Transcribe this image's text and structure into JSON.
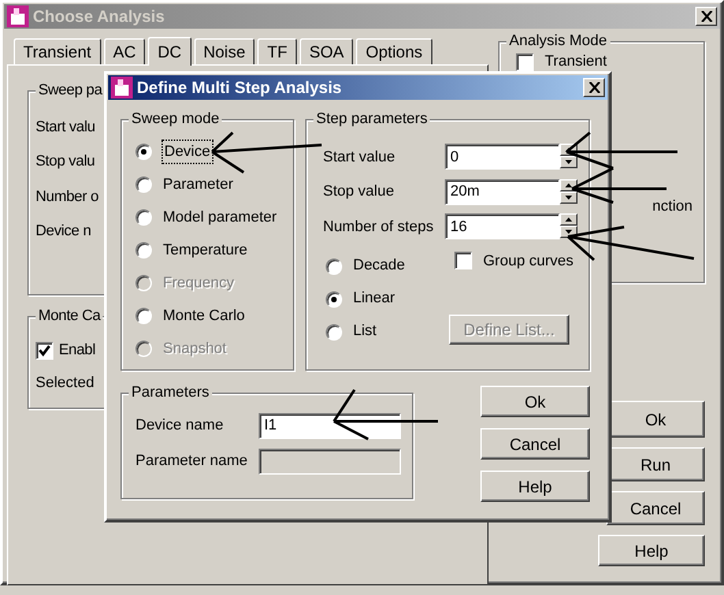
{
  "back_window": {
    "title": "Choose Analysis",
    "active": false,
    "tabs": [
      {
        "label": "Transient",
        "selected": false
      },
      {
        "label": "AC",
        "selected": false
      },
      {
        "label": "DC",
        "selected": true
      },
      {
        "label": "Noise",
        "selected": false
      },
      {
        "label": "TF",
        "selected": false
      },
      {
        "label": "SOA",
        "selected": false
      },
      {
        "label": "Options",
        "selected": false
      }
    ],
    "sweep_group": {
      "title": "Sweep pa",
      "labels": [
        "Start valu",
        "Stop valu",
        "Number o",
        "Device n"
      ]
    },
    "monte_carlo_group": {
      "title": "Monte Ca",
      "enable": {
        "label": "Enabl",
        "checked": true
      },
      "selected_label": "Selected"
    },
    "analysis_mode": {
      "title": "Analysis Mode",
      "transient": {
        "label": "Transient",
        "checked": false
      },
      "cut_label": "nction"
    },
    "buttons": [
      "Ok",
      "Run",
      "Cancel",
      "Help"
    ]
  },
  "dialog": {
    "title": "Define Multi Step Analysis",
    "active": true,
    "sweep_mode": {
      "title": "Sweep mode",
      "options": [
        {
          "label": "Device",
          "selected": true,
          "disabled": false
        },
        {
          "label": "Parameter",
          "selected": false,
          "disabled": false
        },
        {
          "label": "Model parameter",
          "selected": false,
          "disabled": false
        },
        {
          "label": "Temperature",
          "selected": false,
          "disabled": false
        },
        {
          "label": "Frequency",
          "selected": false,
          "disabled": true
        },
        {
          "label": "Monte Carlo",
          "selected": false,
          "disabled": false
        },
        {
          "label": "Snapshot",
          "selected": false,
          "disabled": true
        }
      ]
    },
    "step_parameters": {
      "title": "Step parameters",
      "fields": [
        {
          "label": "Start value",
          "value": "0"
        },
        {
          "label": "Stop value",
          "value": "20m"
        },
        {
          "label": "Number of steps",
          "value": "16"
        }
      ],
      "scale_options": [
        {
          "label": "Decade",
          "selected": false
        },
        {
          "label": "Linear",
          "selected": true
        },
        {
          "label": "List",
          "selected": false
        }
      ],
      "group_curves": {
        "label": "Group curves",
        "checked": false
      },
      "define_list": {
        "label": "Define List...",
        "disabled": true
      }
    },
    "parameters": {
      "title": "Parameters",
      "fields": [
        {
          "label": "Device name",
          "value": "I1",
          "disabled": false
        },
        {
          "label": "Parameter name",
          "disabled": true
        }
      ]
    },
    "buttons": [
      "Ok",
      "Cancel",
      "Help"
    ]
  }
}
